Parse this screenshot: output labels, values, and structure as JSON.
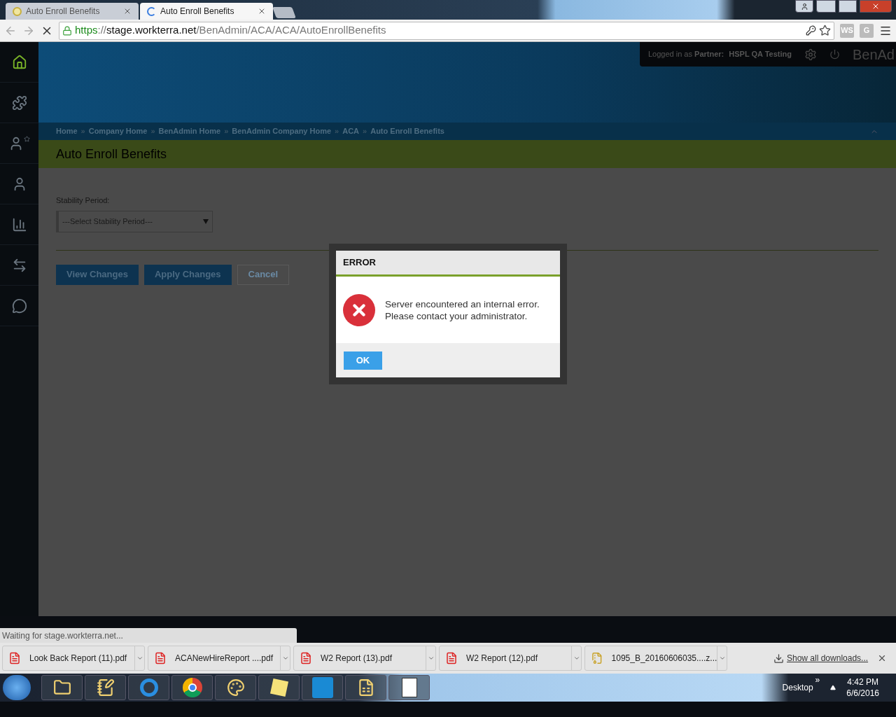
{
  "browser": {
    "tabs": [
      {
        "title": "Auto Enroll Benefits",
        "selected": false,
        "loading": false
      },
      {
        "title": "Auto Enroll Benefits",
        "selected": true,
        "loading": true
      }
    ],
    "url_parts": [
      {
        "kind": "scheme",
        "text": "https"
      },
      {
        "kind": "sep",
        "text": "://"
      },
      {
        "kind": "host",
        "text": "stage.workterra.net"
      },
      {
        "kind": "path",
        "text": "/BenAdmin/ACA/ACA/AutoEnrollBenefits"
      }
    ],
    "extensions": [
      "WS",
      "G"
    ]
  },
  "sidebar": [
    {
      "kind": "home",
      "selected": true
    },
    {
      "kind": "puzzle",
      "selected": false
    },
    {
      "kind": "user-star",
      "selected": false
    },
    {
      "kind": "user",
      "selected": false
    },
    {
      "kind": "chart",
      "selected": false
    },
    {
      "kind": "transfer",
      "selected": false
    },
    {
      "kind": "chat",
      "selected": false
    }
  ],
  "header": {
    "logged_in": "Logged in as",
    "partner_label": "Partner:",
    "partner_name": "HSPL QA Testing",
    "brand": "BenAd"
  },
  "breadcrumbs": [
    "Home",
    "Company Home",
    "BenAdmin Home",
    "BenAdmin Company Home",
    "ACA",
    "Auto Enroll Benefits"
  ],
  "breadcrumb_separator": "»",
  "page_title": "Auto Enroll Benefits",
  "form": {
    "label": "Stability Period:",
    "select_value": "---Select Stability Period---"
  },
  "buttons": [
    {
      "label": "View Changes",
      "kind": "primary"
    },
    {
      "label": "Apply Changes",
      "kind": "primary"
    },
    {
      "label": "Cancel",
      "kind": "secondary"
    }
  ],
  "dialog": {
    "title": "ERROR",
    "message": [
      "Server encountered an internal error.",
      "Please contact your administrator."
    ],
    "ok": "OK"
  },
  "status_text": "Waiting for stage.workterra.net...",
  "downloads": [
    {
      "name": "Look Back Report (11).pdf",
      "kind": "pdf"
    },
    {
      "name": "ACANewHireReport ....pdf",
      "kind": "pdf"
    },
    {
      "name": "W2 Report (13).pdf",
      "kind": "pdf"
    },
    {
      "name": "W2 Report (12).pdf",
      "kind": "pdf"
    },
    {
      "name": "1095_B_20160606035....z...",
      "kind": "zip"
    }
  ],
  "show_all": "Show all downloads...",
  "taskbar": {
    "desktop": "Desktop",
    "overflow": "»",
    "time": "4:42 PM",
    "date": "6/6/2016"
  }
}
